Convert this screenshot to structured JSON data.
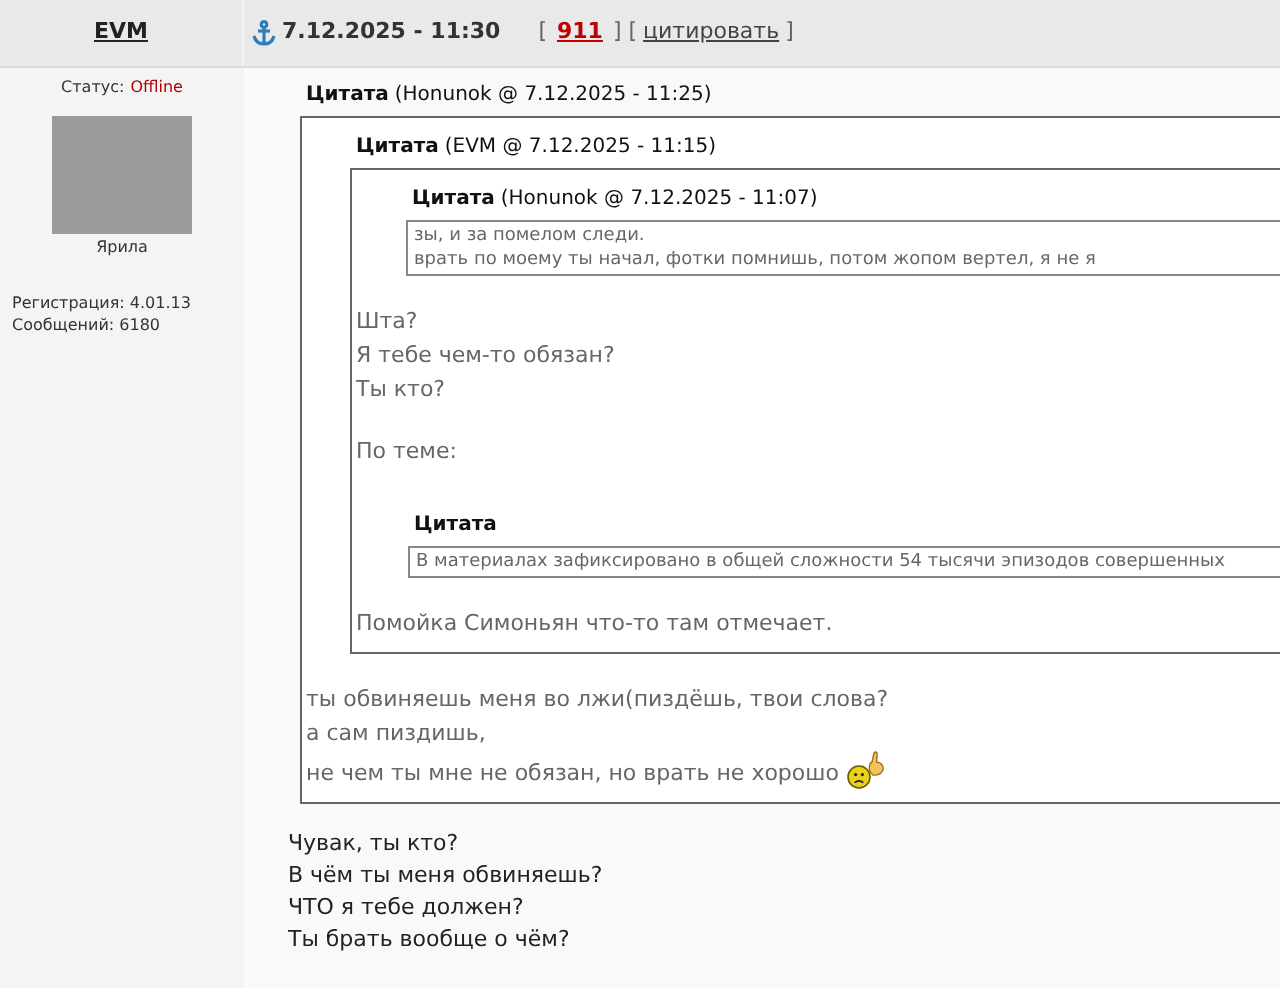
{
  "author": {
    "name": "EVM",
    "status_label": "Статус:",
    "status": "Offline",
    "avatar_caption": "Ярила",
    "registration": "Регистрация: 4.01.13",
    "messages": "Сообщений: 6180"
  },
  "post_header": {
    "datetime": "7.12.2025 - 11:30",
    "open_bracket": "[",
    "post_number": "911",
    "separator": "] [",
    "quote_link": "цитировать",
    "close_bracket": "]"
  },
  "body": [
    {
      "kind": "quote",
      "label": "Цитата",
      "meta": "(Honunok @ 7.12.2025 - 11:25)",
      "compact": false,
      "body": [
        {
          "kind": "quote",
          "label": "Цитата",
          "meta": "(EVM @ 7.12.2025 - 11:15)",
          "compact": false,
          "body": [
            {
              "kind": "quote",
              "label": "Цитата",
              "meta": "(Honunok @ 7.12.2025 - 11:07)",
              "compact": true,
              "body": [
                {
                  "kind": "paragraph",
                  "lines": [
                    "зы, и за помелом следи.",
                    "врать по моему ты начал, фотки помнишь, потом жопом вертел, я не я"
                  ]
                }
              ]
            },
            {
              "kind": "paragraph",
              "lines": [
                "Шта?",
                "Я тебе чем-то обязан?",
                "Ты кто?"
              ]
            },
            {
              "kind": "paragraph",
              "lines": [
                "По теме:"
              ]
            },
            {
              "kind": "quote",
              "label": "Цитата",
              "compact": true,
              "body": [
                {
                  "kind": "paragraph",
                  "lines": [
                    "В материалах зафиксировано в общей сложности 54 тысячи эпизодов совершенных"
                  ]
                }
              ]
            },
            {
              "kind": "paragraph",
              "lines": [
                "Помойка Симоньян что-то там отмечает."
              ]
            }
          ]
        },
        {
          "kind": "paragraph",
          "lines": [
            "ты обвиняешь меня во лжи(пиздёшь, твои слова?",
            "а сам пиздишь,",
            "не чем ты мне не обязан, но врать не хорошо"
          ],
          "smiley": true
        }
      ]
    },
    {
      "kind": "paragraph",
      "lines": [
        "Чувак, ты кто?",
        "В чём ты меня обвиняешь?",
        "ЧТО я тебе должен?",
        "Ты брать вообще о чём?"
      ]
    }
  ]
}
